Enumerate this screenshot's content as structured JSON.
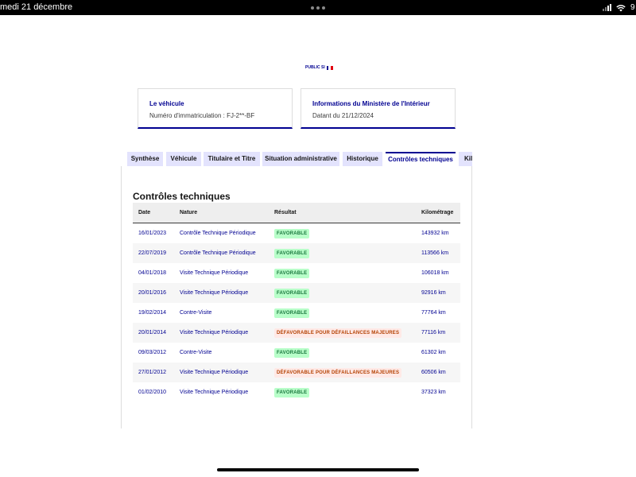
{
  "status_bar": {
    "time_date": "medi 21 décembre",
    "battery": "9"
  },
  "logo": {
    "text": "PUBLIC SI",
    "flag_colors": [
      "#000091",
      "#ffffff",
      "#e1000f"
    ]
  },
  "cards": [
    {
      "title": "Le véhicule",
      "text": "Numéro d'immatriculation : FJ-2**-BF"
    },
    {
      "title": "Informations du Ministère de l'Intérieur",
      "text": "Datant du 21/12/2024"
    }
  ],
  "tabs": [
    {
      "label": "Synthèse",
      "active": false
    },
    {
      "label": "Véhicule",
      "active": false
    },
    {
      "label": "Titulaire et Titre",
      "active": false
    },
    {
      "label": "Situation administrative",
      "active": false
    },
    {
      "label": "Historique",
      "active": false
    },
    {
      "label": "Contrôles techniques",
      "active": true
    },
    {
      "label": "Kil",
      "active": false
    }
  ],
  "section_title": "Contrôles techniques",
  "table": {
    "headers": {
      "date": "Date",
      "nature": "Nature",
      "result": "Résultat",
      "km": "Kilométrage"
    },
    "rows": [
      {
        "date": "16/01/2023",
        "nature": "Contrôle Technique Périodique",
        "result": "FAVORABLE",
        "status": "ok",
        "km": "143932 km"
      },
      {
        "date": "22/07/2019",
        "nature": "Contrôle Technique Périodique",
        "result": "FAVORABLE",
        "status": "ok",
        "km": "113566 km"
      },
      {
        "date": "04/01/2018",
        "nature": "Visite Technique Périodique",
        "result": "FAVORABLE",
        "status": "ok",
        "km": "106018 km"
      },
      {
        "date": "20/01/2016",
        "nature": "Visite Technique Périodique",
        "result": "FAVORABLE",
        "status": "ok",
        "km": "92916 km"
      },
      {
        "date": "19/02/2014",
        "nature": "Contre-Visite",
        "result": "FAVORABLE",
        "status": "ok",
        "km": "77764 km"
      },
      {
        "date": "20/01/2014",
        "nature": "Visite Technique Périodique",
        "result": "DÉFAVORABLE POUR DÉFAILLANCES MAJEURES",
        "status": "ko",
        "km": "77116 km"
      },
      {
        "date": "09/03/2012",
        "nature": "Contre-Visite",
        "result": "FAVORABLE",
        "status": "ok",
        "km": "61302 km"
      },
      {
        "date": "27/01/2012",
        "nature": "Visite Technique Périodique",
        "result": "DÉFAVORABLE POUR DÉFAILLANCES MAJEURES",
        "status": "ko",
        "km": "60506 km"
      },
      {
        "date": "01/02/2010",
        "nature": "Visite Technique Périodique",
        "result": "FAVORABLE",
        "status": "ok",
        "km": "37323 km"
      }
    ]
  },
  "colors": {
    "primary": "#000091",
    "tab_bg": "#e3e3fd",
    "success_bg": "#b8fec9",
    "success_text": "#18753c",
    "error_bg": "#ffe9e6",
    "error_text": "#b34000"
  }
}
